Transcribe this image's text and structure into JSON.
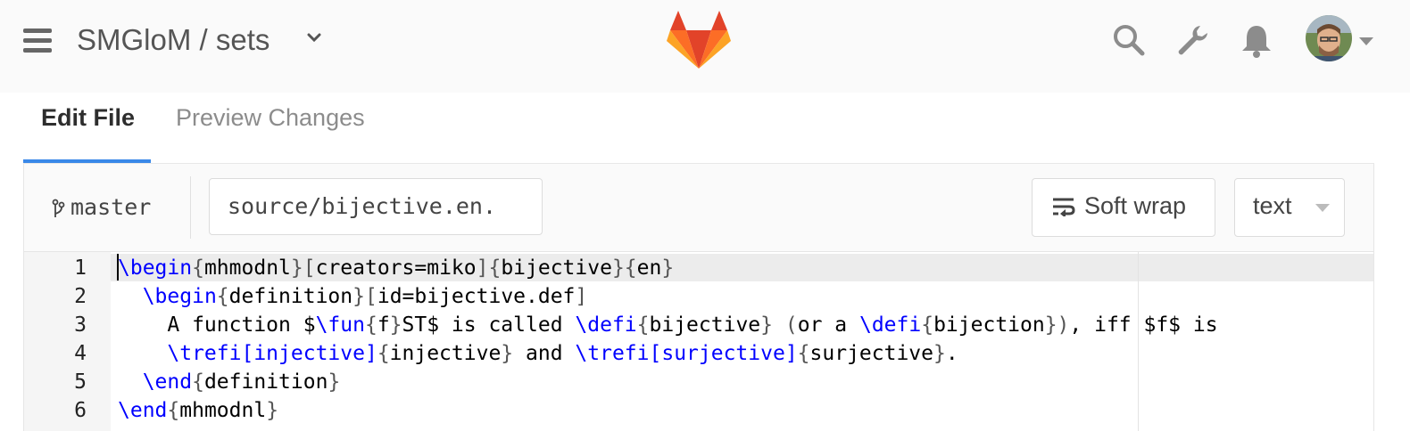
{
  "header": {
    "project": "SMGloM / sets",
    "icons": [
      "menu-icon",
      "chevron-down-icon",
      "gitlab-logo",
      "search-icon",
      "wrench-icon",
      "bell-icon",
      "avatar",
      "caret-down-icon"
    ]
  },
  "tabs": [
    {
      "label": "Edit File",
      "active": true
    },
    {
      "label": "Preview Changes",
      "active": false
    }
  ],
  "filebar": {
    "branch": "master",
    "file_path": "source/bijective.en.",
    "soft_wrap_label": "Soft wrap",
    "mode": "text"
  },
  "editor": {
    "lines": [
      {
        "n": "1",
        "code": [
          {
            "t": "\\begin",
            "c": "kw"
          },
          {
            "t": "{",
            "c": "br"
          },
          {
            "t": "mhmodnl"
          },
          {
            "t": "}[",
            "c": "br"
          },
          {
            "t": "creators=miko"
          },
          {
            "t": "]{",
            "c": "br"
          },
          {
            "t": "bijective"
          },
          {
            "t": "}{",
            "c": "br"
          },
          {
            "t": "en"
          },
          {
            "t": "}",
            "c": "br"
          }
        ]
      },
      {
        "n": "2",
        "code": [
          {
            "t": "  "
          },
          {
            "t": "\\begin",
            "c": "kw"
          },
          {
            "t": "{",
            "c": "br"
          },
          {
            "t": "definition"
          },
          {
            "t": "}[",
            "c": "br"
          },
          {
            "t": "id=bijective.def"
          },
          {
            "t": "]",
            "c": "br"
          }
        ]
      },
      {
        "n": "3",
        "code": [
          {
            "t": "    A function $"
          },
          {
            "t": "\\fun",
            "c": "kw"
          },
          {
            "t": "{",
            "c": "br"
          },
          {
            "t": "f"
          },
          {
            "t": "}",
            "c": "br"
          },
          {
            "t": "ST$ is called "
          },
          {
            "t": "\\defi",
            "c": "kw"
          },
          {
            "t": "{",
            "c": "br"
          },
          {
            "t": "bijective"
          },
          {
            "t": "}",
            "c": "br"
          },
          {
            "t": " "
          },
          {
            "t": "(",
            "c": "br"
          },
          {
            "t": "or a "
          },
          {
            "t": "\\defi",
            "c": "kw"
          },
          {
            "t": "{",
            "c": "br"
          },
          {
            "t": "bijection"
          },
          {
            "t": "})",
            "c": "br"
          },
          {
            "t": ", iff $f$ is"
          }
        ]
      },
      {
        "n": "4",
        "code": [
          {
            "t": "    "
          },
          {
            "t": "\\trefi",
            "c": "kw"
          },
          {
            "t": "[injective]",
            "c": "kw"
          },
          {
            "t": "{",
            "c": "br"
          },
          {
            "t": "injective"
          },
          {
            "t": "}",
            "c": "br"
          },
          {
            "t": " and "
          },
          {
            "t": "\\trefi",
            "c": "kw"
          },
          {
            "t": "[surjective]",
            "c": "kw"
          },
          {
            "t": "{",
            "c": "br"
          },
          {
            "t": "surjective"
          },
          {
            "t": "}",
            "c": "br"
          },
          {
            "t": "."
          }
        ]
      },
      {
        "n": "5",
        "code": [
          {
            "t": "  "
          },
          {
            "t": "\\end",
            "c": "kw"
          },
          {
            "t": "{",
            "c": "br"
          },
          {
            "t": "definition"
          },
          {
            "t": "}",
            "c": "br"
          }
        ]
      },
      {
        "n": "6",
        "code": [
          {
            "t": "\\end",
            "c": "kw"
          },
          {
            "t": "{",
            "c": "br"
          },
          {
            "t": "mhmodnl"
          },
          {
            "t": "}",
            "c": "br"
          }
        ]
      }
    ]
  },
  "colors": {
    "accent": "#3a88e8",
    "keyword": "#0000ff",
    "gitlab_orange": "#fc6d26",
    "gitlab_red": "#e24329",
    "gitlab_yellow": "#fca326"
  }
}
